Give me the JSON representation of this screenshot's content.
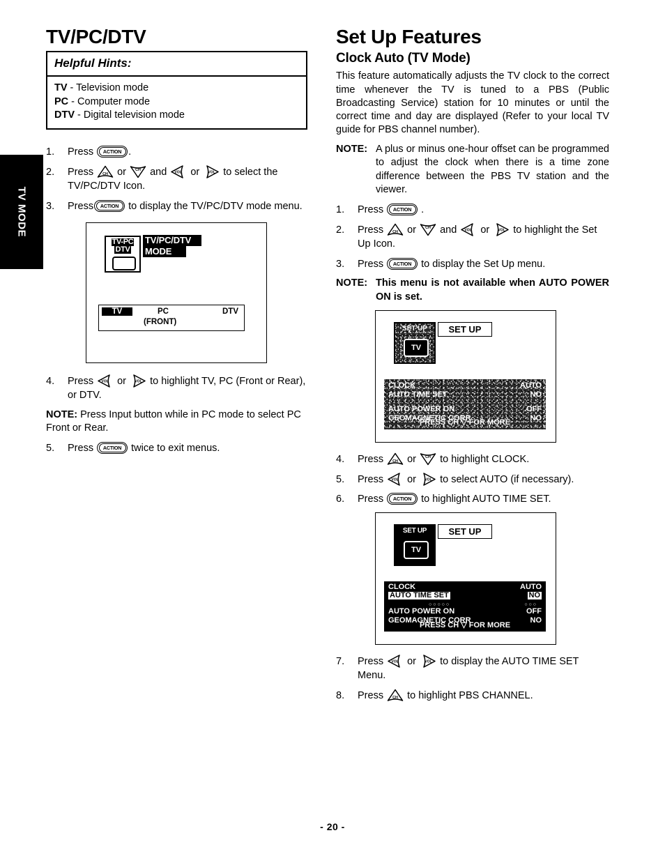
{
  "page": {
    "number_label": "- 20 -",
    "side_tab": "TV MODE"
  },
  "left_column": {
    "title": "TV/PC/DTV",
    "hints": {
      "heading": "Helpful Hints:",
      "items": [
        {
          "term": "TV",
          "dash": " - ",
          "desc": "Television mode"
        },
        {
          "term": "PC",
          "dash": " - ",
          "desc": "Computer mode"
        },
        {
          "term": "DTV",
          "dash": " - ",
          "desc": "Digital television mode"
        }
      ]
    },
    "steps": [
      {
        "num": "1.",
        "before": "Press ",
        "keys": [
          "action"
        ],
        "after": "."
      },
      {
        "num": "2.",
        "before": "Press ",
        "keys": [
          "ch-up",
          "ch-down",
          "vol-left",
          "vol-right"
        ],
        "mid1": " or ",
        "mid2": " and ",
        "mid3": " or ",
        "after": " to select the TV/PC/DTV Icon."
      },
      {
        "num": "3.",
        "before": "Press",
        "keys": [
          "action"
        ],
        "after": " to display the TV/PC/DTV mode menu."
      },
      {
        "num": "4.",
        "before": "Press ",
        "keys": [
          "vol-left",
          "vol-right"
        ],
        "mid1": " or ",
        "after": " to highlight TV, PC (Front or Rear), or DTV."
      },
      {
        "num": "5.",
        "before": "Press ",
        "keys": [
          "action"
        ],
        "after": " twice to exit menus."
      }
    ],
    "note": {
      "label": "NOTE:",
      "text": " Press Input button while in PC mode to select PC Front or Rear."
    },
    "osd": {
      "icon_line1": "TV-PC",
      "icon_line2": "DTV",
      "banner_line1": "TV/PC/DTV",
      "banner_line2": "MODE",
      "selected": "TV",
      "option_pc": "PC",
      "option_dtv": "DTV",
      "option_pc_sub": "(FRONT)"
    }
  },
  "right_column": {
    "title": "Set Up Features",
    "subtitle": "Clock Auto (TV Mode)",
    "intro": "This feature automatically adjusts the TV clock to the correct time whenever the TV is tuned to a PBS (Public Broadcasting Service) station for 10 minutes or until the correct time and day are displayed (Refer to your local TV guide for PBS channel number).",
    "note1": {
      "label": "NOTE:",
      "text": "A plus or minus one-hour offset can be programmed to adjust the clock when there is a time zone difference between the PBS TV station and the viewer."
    },
    "note2": {
      "label": "NOTE:",
      "text_bold": "This menu is not available when AUTO POWER ON is set",
      "text_tail": "."
    },
    "steps": [
      {
        "num": "1.",
        "before": "Press ",
        "keys": [
          "action"
        ],
        "after": " ."
      },
      {
        "num": "2.",
        "before": "Press ",
        "keys": [
          "ch-up",
          "ch-down",
          "vol-left",
          "vol-right"
        ],
        "mid1": " or ",
        "mid2": " and ",
        "mid3": " or ",
        "after": " to highlight the Set Up Icon."
      },
      {
        "num": "3.",
        "before": "Press ",
        "keys": [
          "action"
        ],
        "after": " to display the Set Up menu."
      },
      {
        "num": "4.",
        "before": "Press ",
        "keys": [
          "ch-up",
          "ch-down"
        ],
        "mid1": " or ",
        "after": " to highlight CLOCK."
      },
      {
        "num": "5.",
        "before": "Press ",
        "keys": [
          "vol-left",
          "vol-right"
        ],
        "mid1": " or ",
        "after": " to select AUTO (if necessary)."
      },
      {
        "num": "6.",
        "before": "Press ",
        "keys": [
          "action"
        ],
        "after": " to highlight AUTO TIME SET."
      },
      {
        "num": "7.",
        "before": "Press ",
        "keys": [
          "vol-left",
          "vol-right"
        ],
        "mid1": " or ",
        "after": " to display the AUTO TIME SET Menu."
      },
      {
        "num": "8.",
        "before": "Press ",
        "keys": [
          "ch-up"
        ],
        "after": " to highlight PBS CHANNEL."
      }
    ],
    "osd1": {
      "icon_caption": "SET UP",
      "icon_screen_label": "TV",
      "banner": "SET UP",
      "rows": [
        {
          "label": "CLOCK",
          "value": "AUTO",
          "highlight": false
        },
        {
          "label": "AUTO TIME SET",
          "value": "NO",
          "highlight": false
        },
        {
          "label": "AUTO POWER ON",
          "value": "OFF",
          "highlight": false
        },
        {
          "label": "GEOMAGNETIC CORR",
          "value": "NO",
          "highlight": false
        }
      ],
      "footer": "PRESS CH ▽ FOR MORE"
    },
    "osd2": {
      "icon_caption": "SET UP",
      "icon_screen_label": "TV",
      "banner": "SET UP",
      "rows": [
        {
          "label": "CLOCK",
          "value": "AUTO",
          "highlight": false
        },
        {
          "label": "AUTO TIME SET",
          "value": "NO",
          "highlight": true
        },
        {
          "label": "AUTO POWER ON",
          "value": "OFF",
          "highlight": false
        },
        {
          "label": "GEOMAGNETIC CORR",
          "value": "NO",
          "highlight": false
        }
      ],
      "footer": "PRESS CH ▽ FOR MORE"
    }
  },
  "glyphs": {
    "action_label": "ACTION",
    "ch_label": "CH",
    "vol_label": "VOL"
  }
}
